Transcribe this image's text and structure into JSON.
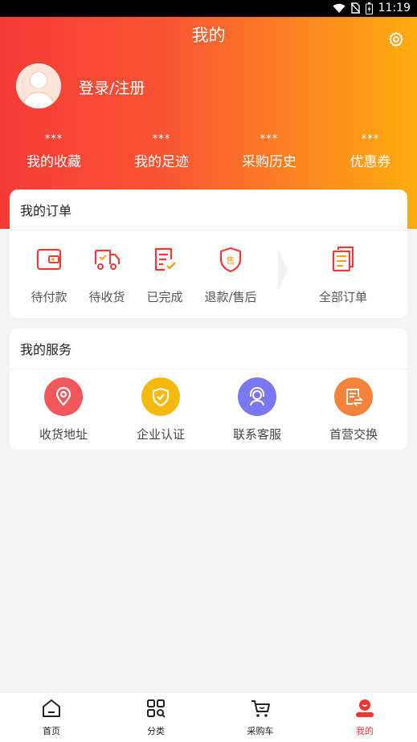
{
  "status_bar": {
    "time": "11:19"
  },
  "header": {
    "title": "我的"
  },
  "profile": {
    "login_label": "登录/注册"
  },
  "stats": [
    {
      "value": "***",
      "label": "我的收藏"
    },
    {
      "value": "***",
      "label": "我的足迹"
    },
    {
      "value": "***",
      "label": "采购历史"
    },
    {
      "value": "***",
      "label": "优惠券"
    }
  ],
  "orders": {
    "title": "我的订单",
    "items": [
      {
        "label": "待付款",
        "icon": "wallet-icon"
      },
      {
        "label": "待收货",
        "icon": "truck-icon"
      },
      {
        "label": "已完成",
        "icon": "completed-doc-icon"
      },
      {
        "label": "退款/售后",
        "icon": "after-sale-shield-icon"
      },
      {
        "label": "全部订单",
        "icon": "order-list-icon"
      }
    ]
  },
  "services": {
    "title": "我的服务",
    "items": [
      {
        "label": "收货地址",
        "icon": "location-pin-icon",
        "color": "#f2585b"
      },
      {
        "label": "企业认证",
        "icon": "verified-shield-icon",
        "color": "#f8b90e"
      },
      {
        "label": "联系客服",
        "icon": "headset-agent-icon",
        "color": "#7878f0"
      },
      {
        "label": "首营交换",
        "icon": "exchange-doc-icon",
        "color": "#f5843a"
      }
    ]
  },
  "tabbar": {
    "items": [
      {
        "label": "首页",
        "icon": "home-icon",
        "active": false
      },
      {
        "label": "分类",
        "icon": "category-grid-icon",
        "active": false
      },
      {
        "label": "采购车",
        "icon": "cart-icon",
        "active": false
      },
      {
        "label": "我的",
        "icon": "profile-icon",
        "active": true
      }
    ]
  },
  "colors": {
    "accent": "#f2362e",
    "gradient_start": "#f63b37",
    "gradient_end": "#ffac0d"
  }
}
